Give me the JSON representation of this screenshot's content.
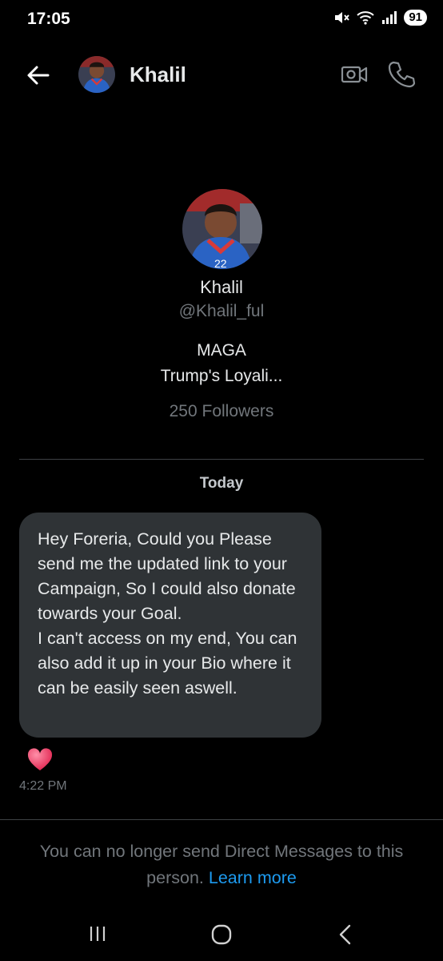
{
  "status_bar": {
    "time": "17:05",
    "icons": [
      "mute-icon",
      "wifi-icon",
      "signal-icon"
    ],
    "battery": "91"
  },
  "header": {
    "title": "Khalil",
    "back_icon": "arrow-left-icon",
    "video_icon": "video-camera-icon",
    "call_icon": "phone-icon"
  },
  "profile": {
    "name": "Khalil",
    "handle": "@Khalil_ful",
    "bio_line1": "MAGA",
    "bio_line2": "Trump's Loyali...",
    "followers": "250 Followers"
  },
  "conversation": {
    "day_label": "Today",
    "messages": [
      {
        "text": "Hey Foreria, Could you Please send me the updated link to your Campaign, So I could also donate towards your Goal.\nI can't access on my end, You can also add it up in your Bio where it can be easily seen aswell.",
        "reaction": "heart-emoji",
        "time": "4:22 PM"
      }
    ]
  },
  "footer": {
    "notice": "You can no longer send Direct Messages to this person.",
    "link": "Learn more"
  },
  "colors": {
    "background": "#000000",
    "bubble": "#2f3336",
    "link": "#1d9bf0",
    "muted": "#71767b"
  }
}
